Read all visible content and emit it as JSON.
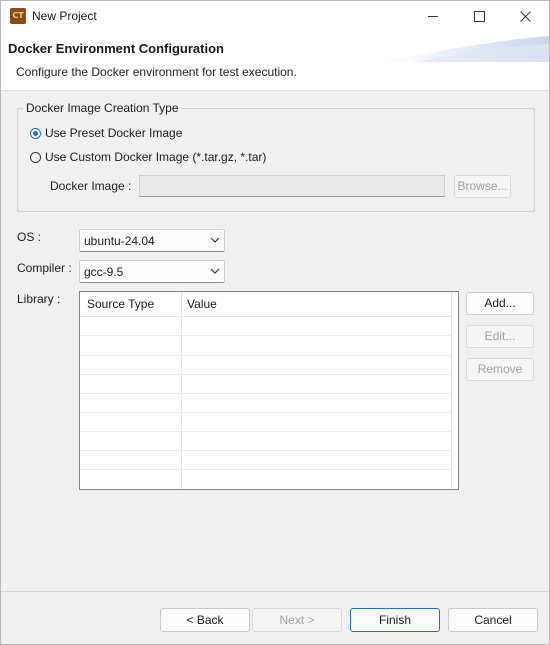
{
  "window": {
    "app_icon_text": "CT",
    "title": "New Project",
    "controls": [
      "minimize-icon",
      "maximize-icon",
      "close-icon"
    ]
  },
  "header": {
    "title": "Docker Environment Configuration",
    "description": "Configure the Docker environment for test execution."
  },
  "image_group": {
    "legend": "Docker Image Creation Type",
    "options": [
      {
        "label": "Use Preset Docker Image",
        "checked": true
      },
      {
        "label": "Use Custom Docker Image (*.tar.gz, *.tar)",
        "checked": false
      }
    ],
    "docker_image_label": "Docker Image :",
    "docker_image_value": "",
    "browse_label": "Browse..."
  },
  "os": {
    "label": "OS :",
    "value": "ubuntu-24.04"
  },
  "compiler": {
    "label": "Compiler :",
    "value": "gcc-9.5"
  },
  "library": {
    "label": "Library :",
    "columns": [
      "Source Type",
      "Value"
    ],
    "rows": [],
    "buttons": {
      "add": "Add...",
      "edit": "Edit...",
      "remove": "Remove"
    }
  },
  "footer": {
    "back": "< Back",
    "next": "Next >",
    "finish": "Finish",
    "cancel": "Cancel"
  },
  "colors": {
    "accent": "#1a73c8",
    "window_bg": "#f0f0f0"
  }
}
